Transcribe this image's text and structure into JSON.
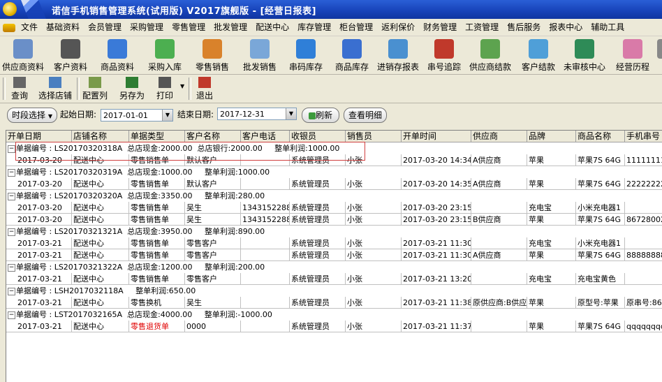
{
  "window": {
    "title": "诺信手机销售管理系统(试用版)   V2017旗舰版 - [经营日报表]"
  },
  "menu": [
    "文件",
    "基础资料",
    "会员管理",
    "采购管理",
    "零售管理",
    "批发管理",
    "配送中心",
    "库存管理",
    "柜台管理",
    "返利保价",
    "财务管理",
    "工资管理",
    "售后服务",
    "报表中心",
    "辅助工具"
  ],
  "toolbar": [
    "供应商资料",
    "客户资料",
    "商品资料",
    "采购入库",
    "零售销售",
    "批发销售",
    "串码库存",
    "商品库存",
    "进销存报表",
    "串号追踪",
    "供应商结款",
    "客户结款",
    "未审核中心",
    "经营历程",
    "返"
  ],
  "toolbar_icon_colors": [
    "#6a8fc8",
    "#555555",
    "#3a7ad8",
    "#4caf50",
    "#d9822b",
    "#7aa7d8",
    "#2f7fd8",
    "#3a6fd0",
    "#4a90d0",
    "#c0392b",
    "#5da34f",
    "#4f9fd8",
    "#2e8b57",
    "#d97aa8",
    "#888888"
  ],
  "toolbar2": [
    "查询",
    "选择店铺",
    "配置列",
    "另存为",
    "打印",
    "退出"
  ],
  "filter": {
    "period_label": "时段选择",
    "start_label": "起始日期:",
    "start_value": "2017-01-01",
    "end_label": "结束日期:",
    "end_value": "2017-12-31",
    "refresh": "刷新",
    "detail": "查看明细"
  },
  "columns": [
    "开单日期",
    "店铺名称",
    "单据类型",
    "客户名称",
    "客户电话",
    "收银员",
    "销售员",
    "开单时间",
    "供应商",
    "品牌",
    "商品名称",
    "手机串号"
  ],
  "groups": [
    {
      "text": "单据编号 : LS20170320318A  总店现金:2000.00  总店银行:2000.00     整单利润:1000.00",
      "rows": [
        [
          "2017-03-20",
          "配送中心",
          "零售销售单",
          "默认客户",
          "",
          "系统管理员",
          "小张",
          "2017-03-20 14:34",
          "A供应商",
          "苹果",
          "苹果7S 64G",
          "1111111111"
        ]
      ]
    },
    {
      "text": "单据编号 : LS20170320319A  总店现金:1000.00     整单利润:1000.00",
      "rows": [
        [
          "2017-03-20",
          "配送中心",
          "零售销售单",
          "默认客户",
          "",
          "系统管理员",
          "小张",
          "2017-03-20 14:35",
          "A供应商",
          "苹果",
          "苹果7S 64G",
          "2222222222"
        ]
      ]
    },
    {
      "text": "单据编号 : LS20170320320A  总店现金:3350.00     整单利润:280.00",
      "rows": [
        [
          "2017-03-20",
          "配送中心",
          "零售销售单",
          "吴生",
          "13431522888",
          "系统管理员",
          "小张",
          "2017-03-20 23:15",
          "",
          "充电宝",
          "小米充电器1",
          ""
        ],
        [
          "2017-03-20",
          "配送中心",
          "零售销售单",
          "吴生",
          "13431522888",
          "系统管理员",
          "小张",
          "2017-03-20 23:15",
          "B供应商",
          "苹果",
          "苹果7S 64G",
          "8672800254"
        ]
      ]
    },
    {
      "text": "单据编号 : LS20170321321A  总店现金:3950.00     整单利润:890.00",
      "rows": [
        [
          "2017-03-21",
          "配送中心",
          "零售销售单",
          "零售客户",
          "",
          "系统管理员",
          "小张",
          "2017-03-21 11:30",
          "",
          "充电宝",
          "小米充电器1",
          ""
        ],
        [
          "2017-03-21",
          "配送中心",
          "零售销售单",
          "零售客户",
          "",
          "系统管理员",
          "小张",
          "2017-03-21 11:30",
          "A供应商",
          "苹果",
          "苹果7S 64G",
          "8888888888"
        ]
      ]
    },
    {
      "text": "单据编号 : LS20170321322A  总店现金:1200.00     整单利润:200.00",
      "rows": [
        [
          "2017-03-21",
          "配送中心",
          "零售销售单",
          "零售客户",
          "",
          "系统管理员",
          "小张",
          "2017-03-21 13:20",
          "",
          "充电宝",
          "充电宝黄色",
          ""
        ]
      ]
    },
    {
      "text": "单据编号 : LSH2017032118A     整单利润:650.00",
      "rows": [
        [
          "2017-03-21",
          "配送中心",
          "零售换机",
          "吴生",
          "",
          "系统管理员",
          "小张",
          "2017-03-21 11:38",
          "原供应商:B供应商",
          "苹果",
          "原型号:苹果",
          "原串号:8672"
        ]
      ]
    },
    {
      "text": "单据编号 : LST2017032165A  总店现金:4000.00     整单利润:-1000.00",
      "rows": [
        [
          "2017-03-21",
          "配送中心",
          "零售退货单",
          "0000",
          "",
          "系统管理员",
          "小张",
          "2017-03-21 11:37",
          "",
          "苹果",
          "苹果7S 64G",
          "qqqqqqqqqq"
        ]
      ]
    }
  ],
  "colors": {
    "title_bar": "#1742b8",
    "return_order": "#e00000",
    "highlight_box": "#d04040"
  }
}
